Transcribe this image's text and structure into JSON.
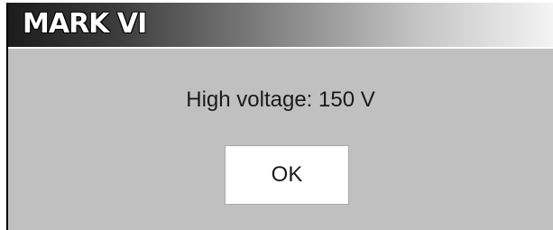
{
  "dialog": {
    "title": "MARK VI",
    "message": "High voltage: 150 V",
    "ok_label": "OK"
  },
  "colors": {
    "dialog_background": "#c0c0c0",
    "title_gradient_start": "#1c1c1c",
    "title_gradient_end": "#f4f4f4",
    "title_text": "#ffffff",
    "button_background": "#ffffff"
  }
}
